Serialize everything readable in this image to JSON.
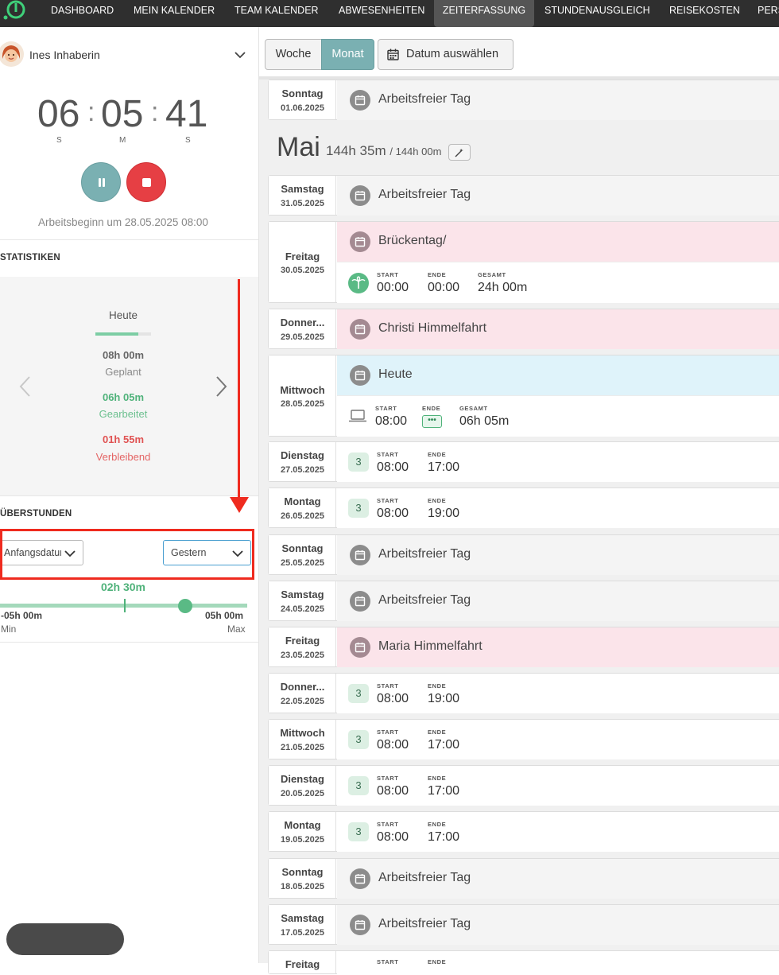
{
  "nav": {
    "items": [
      {
        "label": "DASHBOARD"
      },
      {
        "label": "MEIN KALENDER"
      },
      {
        "label": "TEAM KALENDER"
      },
      {
        "label": "ABWESENHEITEN"
      },
      {
        "label": "ZEITERFASSUNG",
        "active": true
      },
      {
        "label": "STUNDENAUSGLEICH"
      },
      {
        "label": "REISEKOSTEN"
      },
      {
        "label": "PERS"
      }
    ]
  },
  "user": {
    "name": "Ines Inhaberin",
    "icon": "chevron-down-icon"
  },
  "timer": {
    "hours": "06",
    "minutes": "05",
    "seconds": "41",
    "unit_h": "S",
    "unit_m": "M",
    "unit_s": "S",
    "work_start": "Arbeitsbeginn um 28.05.2025 08:00"
  },
  "stats": {
    "title": "STATISTIKEN",
    "period": "Heute",
    "progress": 0.77,
    "planned_value": "08h 00m",
    "planned_label": "Geplant",
    "worked_value": "06h 05m",
    "worked_label": "Gearbeitet",
    "remaining_value": "01h 55m",
    "remaining_label": "Verbleibend"
  },
  "overtime": {
    "title": "ÜBERSTUNDEN",
    "from_select": "Anfangsdatum",
    "to_select": "Gestern",
    "value": "02h 30m",
    "min_value": "-05h 00m",
    "min_label": "Min",
    "max_value": "05h 00m",
    "max_label": "Max",
    "level": 0.75
  },
  "toolbar": {
    "week_label": "Woche",
    "month_label": "Monat",
    "date_label": "Datum auswählen"
  },
  "month": {
    "name": "Mai",
    "hours": "144h 35m",
    "target": "/ 144h 00m"
  },
  "labels": {
    "start": "START",
    "end": "ENDE",
    "total": "GESAMT"
  },
  "colors": {
    "accent": "#7ab0b2",
    "stop": "#e63f44",
    "green": "#4fb27a",
    "red": "#e05252",
    "pink_band": "#fbe4ea",
    "blue_band": "#dff3fa",
    "highlight": "#ef2b1f"
  },
  "days": [
    {
      "dayname": "Sonntag",
      "date": "01.06.2025",
      "text": "Arbeitsfreier Tag"
    },
    {
      "dayname": "Samstag",
      "date": "31.05.2025",
      "text": "Arbeitsfreier Tag"
    },
    {
      "dayname": "Freitag",
      "date": "30.05.2025",
      "text": "Brückentag/",
      "start": "00:00",
      "end": "00:00",
      "total": "24h 00m"
    },
    {
      "dayname": "Donner...",
      "date": "29.05.2025",
      "text": "Christi Himmelfahrt"
    },
    {
      "dayname": "Mittwoch",
      "date": "28.05.2025",
      "text": "Heute",
      "start": "08:00",
      "end": "•••",
      "total": "06h 05m"
    },
    {
      "dayname": "Dienstag",
      "date": "27.05.2025",
      "badge": "3",
      "start": "08:00",
      "end": "17:00"
    },
    {
      "dayname": "Montag",
      "date": "26.05.2025",
      "badge": "3",
      "start": "08:00",
      "end": "19:00"
    },
    {
      "dayname": "Sonntag",
      "date": "25.05.2025",
      "text": "Arbeitsfreier Tag"
    },
    {
      "dayname": "Samstag",
      "date": "24.05.2025",
      "text": "Arbeitsfreier Tag"
    },
    {
      "dayname": "Freitag",
      "date": "23.05.2025",
      "text": "Maria Himmelfahrt"
    },
    {
      "dayname": "Donner...",
      "date": "22.05.2025",
      "badge": "3",
      "start": "08:00",
      "end": "19:00"
    },
    {
      "dayname": "Mittwoch",
      "date": "21.05.2025",
      "badge": "3",
      "start": "08:00",
      "end": "17:00"
    },
    {
      "dayname": "Dienstag",
      "date": "20.05.2025",
      "badge": "3",
      "start": "08:00",
      "end": "17:00"
    },
    {
      "dayname": "Montag",
      "date": "19.05.2025",
      "badge": "3",
      "start": "08:00",
      "end": "17:00"
    },
    {
      "dayname": "Sonntag",
      "date": "18.05.2025",
      "text": "Arbeitsfreier Tag"
    },
    {
      "dayname": "Samstag",
      "date": "17.05.2025",
      "text": "Arbeitsfreier Tag"
    },
    {
      "dayname": "Freitag",
      "start_label": "START",
      "end_label": "ENDE"
    }
  ]
}
